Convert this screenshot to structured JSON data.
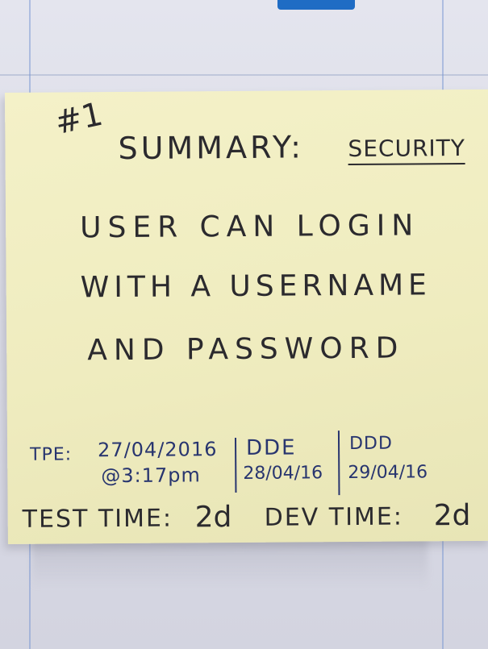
{
  "note": {
    "ticket_number": "#1",
    "summary_label": "SUMMARY:",
    "summary_category": "SECURITY",
    "story_lines": [
      "USER CAN LOGIN",
      "WITH A USERNAME",
      "AND PASSWORD"
    ],
    "tpe": {
      "label": "TPE:",
      "date": "27/04/2016",
      "time": "@3:17pm"
    },
    "dde": {
      "label": "DDE",
      "date": "28/04/16"
    },
    "ddd": {
      "label": "DDD",
      "date": "29/04/16"
    },
    "test_time": {
      "label": "TEST TIME:",
      "value": "2d"
    },
    "dev_time": {
      "label": "DEV TIME:",
      "value": "2d"
    }
  },
  "colors": {
    "sticky_note": "#f2efc4",
    "background_board": "#dcdde8",
    "tape": "#1f6cc4",
    "pencil_ink": "#2b2a2e",
    "pen_ink": "#28356f"
  }
}
